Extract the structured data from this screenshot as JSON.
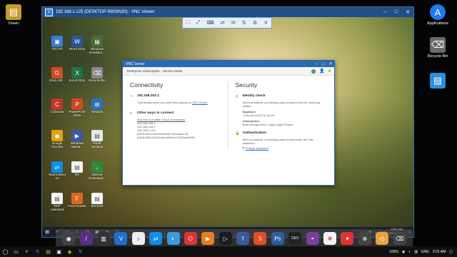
{
  "host": {
    "desktop_icons": [
      {
        "label": "Down",
        "icon": "folder-icon",
        "color": "#c89a2e"
      },
      {
        "label": "Applications",
        "icon": "app-store-icon",
        "color": "#1e7cf2"
      },
      {
        "label": "Recycle Bin",
        "icon": "trash-icon",
        "color": "#6a6a6a"
      },
      {
        "label": "",
        "icon": "folder-icon",
        "color": "#2a8fdc"
      }
    ],
    "taskbar": {
      "zoom": "100%",
      "lang": "ENG",
      "time": "2:01 AM"
    }
  },
  "vnc": {
    "title": "192.168.1.125 (DESKTOP-R8S9N20) - VNC Viewer",
    "toolbar_icons": [
      "fullscreen-icon",
      "scale-icon",
      "ctrl-alt-del-icon",
      "send-keys-icon",
      "chat-icon",
      "transfer-icon",
      "properties-icon",
      "close-icon"
    ]
  },
  "remote_desktop_icons": [
    {
      "label": "This PC",
      "color": "#3a7bd5",
      "glyph": "▣"
    },
    {
      "label": "Word 2016",
      "color": "#2b579a",
      "glyph": "W"
    },
    {
      "label": "Windows\nEmulator...",
      "color": "#4a6a3a",
      "glyph": "▤"
    },
    {
      "label": "Glary Util...",
      "color": "#d04a2a",
      "glyph": "G"
    },
    {
      "label": "Excel 2016",
      "color": "#217346",
      "glyph": "X"
    },
    {
      "label": "Recycle Bin",
      "color": "#888",
      "glyph": "⌫"
    },
    {
      "label": "CCleaner",
      "color": "#c0392b",
      "glyph": "C"
    },
    {
      "label": "PowerPoint\n2016",
      "color": "#d24726",
      "glyph": "P"
    },
    {
      "label": "Network",
      "color": "#2c6fb5",
      "glyph": "⊞"
    },
    {
      "label": "Google\nChrome",
      "color": "#dfa313",
      "glyph": "◉"
    },
    {
      "label": "Windows\nMedia...",
      "color": "#3a5ba0",
      "glyph": "▶"
    },
    {
      "label": "Public\nDesktop",
      "color": "#e9e9e9",
      "glyph": "▤"
    },
    {
      "label": "TeamViewer\n12",
      "color": "#0e8ee9",
      "glyph": "⇄"
    },
    {
      "label": "file",
      "color": "#f3f3f3",
      "glyph": "▤"
    },
    {
      "label": "Internet\nDownload...",
      "color": "#2d8a3a",
      "glyph": "↓"
    },
    {
      "label": "PDF\nUnlimited",
      "color": "#f3f3f3",
      "glyph": "▤"
    },
    {
      "label": "Foxit Reader",
      "color": "#e0661b",
      "glyph": "F"
    },
    {
      "label": "text.html",
      "color": "#f3f3f3",
      "glyph": "▤"
    }
  ],
  "dialog": {
    "title": "VNC Server",
    "subscription": "Enterprise subscription - Service Mode",
    "connectivity": {
      "heading": "Connectivity",
      "ip": "192.168.253.1",
      "connecting_text": "Connecting users can enter this address in",
      "viewer_link": "VNC Viewer",
      "other_ways": "Other ways to connect",
      "cloud_link": "See how to enable Cloud connections",
      "addresses": [
        "192.168.253.1",
        "192.168.144.1",
        "192.168.1.125",
        "[2405:4800:30f4:29ab:63d:10bb:fada:2f]",
        "[2405:4800:30f4:29ab:3065:4e7f:0f39a:6939]"
      ]
    },
    "security": {
      "heading": "Security",
      "identity_title": "Identity check",
      "identity_text": "When prompted, connecting users should check for matching details:",
      "signature_label": "Signature",
      "signature_value": "7c-5d-4c-4a-09-7e-42-2e",
      "catchphrase_label": "Catchphrase",
      "catchphrase_value": "Brain omega triton. Lobby forget France",
      "auth_title": "Authentication",
      "auth_text": "When prompted, connecting users should enter the VNC password.",
      "change_link": "Change password"
    }
  },
  "remote_taskbar": {
    "lang": "ENG",
    "time": "2:01 AM",
    "date": "11/16/2016"
  }
}
